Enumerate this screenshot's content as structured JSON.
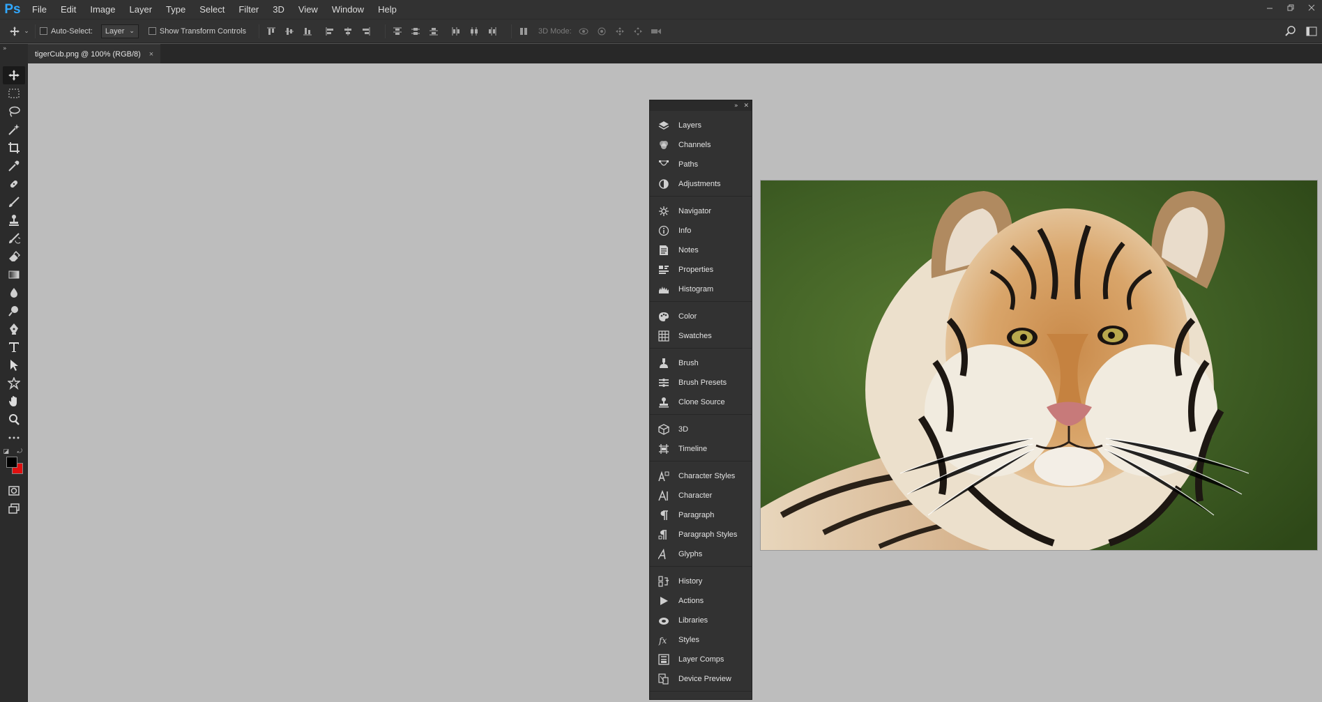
{
  "app": {
    "logo": "Ps"
  },
  "menu": [
    "File",
    "Edit",
    "Image",
    "Layer",
    "Type",
    "Select",
    "Filter",
    "3D",
    "View",
    "Window",
    "Help"
  ],
  "window_controls": [
    "minimize-icon",
    "restore-icon",
    "close-icon"
  ],
  "options": {
    "auto_select_label": "Auto-Select:",
    "auto_select_checked": false,
    "auto_select_target": "Layer",
    "show_transform_label": "Show Transform Controls",
    "show_transform_checked": false,
    "mode_3d_label": "3D Mode:"
  },
  "document_tab": {
    "title": "tigerCub.png @ 100% (RGB/8)",
    "close": "×"
  },
  "colors": {
    "foreground": "#000000",
    "background": "#e01010",
    "accent": "#31a8ff",
    "canvas_bg": "#bdbdbd"
  },
  "tools": [
    "move-tool",
    "marquee-tool",
    "lasso-tool",
    "magic-wand-tool",
    "crop-tool",
    "eyedropper-tool",
    "healing-brush-tool",
    "brush-tool",
    "clone-stamp-tool",
    "history-brush-tool",
    "eraser-tool",
    "gradient-tool",
    "blur-tool",
    "dodge-tool",
    "pen-tool",
    "type-tool",
    "path-selection-tool",
    "shape-tool",
    "hand-tool",
    "zoom-tool",
    "edit-toolbar"
  ],
  "panels": {
    "groups": [
      [
        {
          "label": "Layers",
          "icon": "layers-icon"
        },
        {
          "label": "Channels",
          "icon": "channels-icon"
        },
        {
          "label": "Paths",
          "icon": "paths-icon"
        },
        {
          "label": "Adjustments",
          "icon": "adjustments-icon"
        }
      ],
      [
        {
          "label": "Navigator",
          "icon": "navigator-icon"
        },
        {
          "label": "Info",
          "icon": "info-icon"
        },
        {
          "label": "Notes",
          "icon": "notes-icon"
        },
        {
          "label": "Properties",
          "icon": "properties-icon"
        },
        {
          "label": "Histogram",
          "icon": "histogram-icon"
        }
      ],
      [
        {
          "label": "Color",
          "icon": "color-icon"
        },
        {
          "label": "Swatches",
          "icon": "swatches-icon"
        }
      ],
      [
        {
          "label": "Brush",
          "icon": "brush-icon"
        },
        {
          "label": "Brush Presets",
          "icon": "brush-presets-icon"
        },
        {
          "label": "Clone Source",
          "icon": "clone-source-icon"
        }
      ],
      [
        {
          "label": "3D",
          "icon": "3d-icon"
        },
        {
          "label": "Timeline",
          "icon": "timeline-icon"
        }
      ],
      [
        {
          "label": "Character Styles",
          "icon": "character-styles-icon"
        },
        {
          "label": "Character",
          "icon": "character-icon"
        },
        {
          "label": "Paragraph",
          "icon": "paragraph-icon"
        },
        {
          "label": "Paragraph Styles",
          "icon": "paragraph-styles-icon"
        },
        {
          "label": "Glyphs",
          "icon": "glyphs-icon"
        }
      ],
      [
        {
          "label": "History",
          "icon": "history-icon"
        },
        {
          "label": "Actions",
          "icon": "actions-icon"
        },
        {
          "label": "Libraries",
          "icon": "libraries-icon"
        },
        {
          "label": "Styles",
          "icon": "styles-icon"
        },
        {
          "label": "Layer Comps",
          "icon": "layer-comps-icon"
        },
        {
          "label": "Device Preview",
          "icon": "device-preview-icon"
        }
      ]
    ]
  }
}
